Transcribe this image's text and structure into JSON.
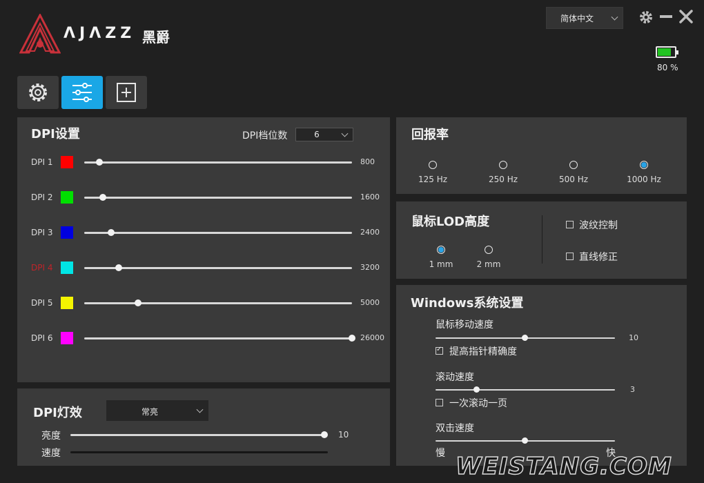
{
  "brand": {
    "name": "ΛJΛZZ",
    "cn": "黑爵"
  },
  "header": {
    "language": "简体中文",
    "battery_pct": "80 %",
    "battery_level": 0.8
  },
  "tabs": [
    {
      "name": "settings",
      "icon": "gear-icon"
    },
    {
      "name": "tuning",
      "icon": "sliders-icon"
    },
    {
      "name": "macro",
      "icon": "add-box-icon"
    }
  ],
  "dpi": {
    "title": "DPI设置",
    "levels_label": "DPI档位数",
    "levels_value": "6",
    "rows": [
      {
        "label": "DPI 1",
        "color": "#ff0000",
        "value": "800",
        "level": 0.03,
        "active": false
      },
      {
        "label": "DPI 2",
        "color": "#00e000",
        "value": "1600",
        "level": 0.07,
        "active": false
      },
      {
        "label": "DPI 3",
        "color": "#0000e0",
        "value": "2400",
        "level": 0.1,
        "active": false
      },
      {
        "label": "DPI 4",
        "color": "#00e5e5",
        "value": "3200",
        "level": 0.13,
        "active": true
      },
      {
        "label": "DPI 5",
        "color": "#f5f500",
        "value": "5000",
        "level": 0.2,
        "active": false
      },
      {
        "label": "DPI 6",
        "color": "#ff00ff",
        "value": "26000",
        "level": 1.0,
        "active": false
      }
    ]
  },
  "dpi_light": {
    "title": "DPI灯效",
    "mode": "常亮",
    "brightness_label": "亮度",
    "brightness_value": "10",
    "brightness_level": 1.0,
    "speed_label": "速度"
  },
  "report_rate": {
    "title": "回报率",
    "options": [
      "125 Hz",
      "250 Hz",
      "500 Hz",
      "1000 Hz"
    ],
    "selected": 3
  },
  "lod": {
    "title": "鼠标LOD高度",
    "options": [
      "1 mm",
      "2 mm"
    ],
    "selected": 0,
    "ripple": "波纹控制",
    "angle_snap": "直线修正"
  },
  "windows": {
    "title": "Windows系统设置",
    "mouse_speed_label": "鼠标移动速度",
    "mouse_speed_value": "10",
    "mouse_speed_level": 0.5,
    "precision_label": "提高指针精确度",
    "precision_checked": true,
    "scroll_label": "滚动速度",
    "scroll_value": "3",
    "scroll_level": 0.23,
    "scroll_page_label": "一次滚动一页",
    "scroll_page_checked": false,
    "dblclick_label": "双击速度",
    "dblclick_level": 0.5,
    "slow": "慢",
    "fast": "快"
  },
  "watermark": "WEISTANG.COM"
}
